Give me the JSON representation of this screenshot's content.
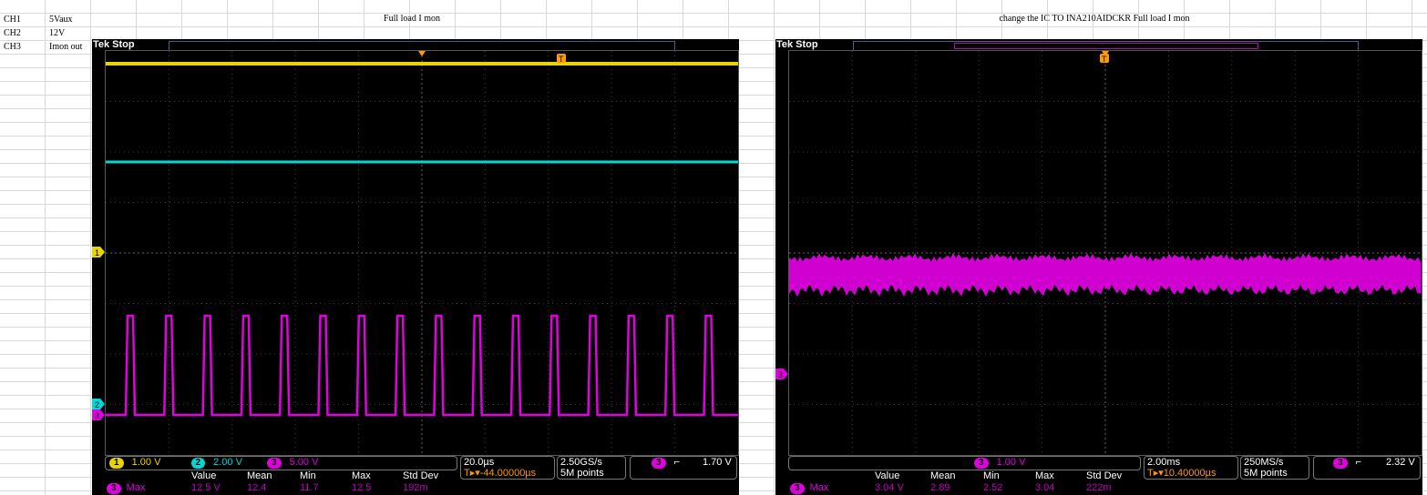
{
  "sheet": {
    "rows": [
      {
        "ch": "CH1",
        "desc": "5Vaux"
      },
      {
        "ch": "CH2",
        "desc": "12V"
      },
      {
        "ch": "CH3",
        "desc": "Imon out"
      }
    ],
    "title_left": "Full load I mon",
    "title_right": "change the IC TO INA210AIDCKR  Full load I mon"
  },
  "scope_left": {
    "brand": "Tek",
    "status": "Stop",
    "ch1_marker": "1",
    "ch2_marker": "2",
    "ch3_marker": "3",
    "trigger_marker": "T",
    "ch1_scale": "1.00 V",
    "ch2_scale": "2.00 V",
    "ch3_scale": "5.00 V",
    "timebase": "20.0µs",
    "trig_pos": "-44.00000µs",
    "sample_rate": "2.50GS/s",
    "record": "5M points",
    "trig_ch": "3",
    "trig_level": "1.70 V",
    "meas": {
      "headers": [
        "Value",
        "Mean",
        "Min",
        "Max",
        "Std Dev"
      ],
      "label": "Max",
      "values": [
        "12.5 V",
        "12.4",
        "11.7",
        "12.5",
        "192m"
      ]
    },
    "colors": {
      "ch1": "#e8d400",
      "ch2": "#00d8d8",
      "ch3": "#e000e0",
      "trigger": "#ff9a00"
    }
  },
  "scope_right": {
    "brand": "Tek",
    "status": "Stop",
    "ch3_marker": "3",
    "trigger_marker": "T",
    "ch3_scale": "1.00 V",
    "timebase": "2.00ms",
    "trig_pos": "10.40000µs",
    "sample_rate": "250MS/s",
    "record": "5M points",
    "trig_ch": "3",
    "trig_level": "2.32 V",
    "meas": {
      "headers": [
        "Value",
        "Mean",
        "Min",
        "Max",
        "Std Dev"
      ],
      "label": "Max",
      "values": [
        "3.04 V",
        "2.89",
        "2.52",
        "3.04",
        "222m"
      ]
    }
  }
}
